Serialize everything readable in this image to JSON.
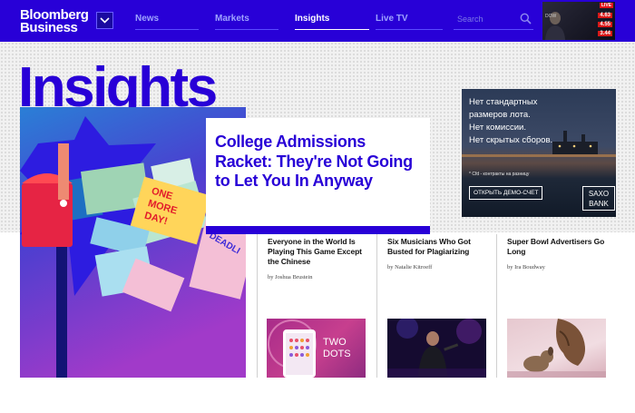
{
  "header": {
    "logo_line1": "Bloomberg",
    "logo_line2": "Business",
    "nav": [
      {
        "label": "News"
      },
      {
        "label": "Markets"
      },
      {
        "label": "Insights"
      },
      {
        "label": "Live TV"
      }
    ],
    "search_placeholder": "Search",
    "live_tv": {
      "badge": "LIVE",
      "tickers": [
        {
          "label": "DOW",
          "value": "4.63"
        },
        {
          "label": "",
          "value": "4.55"
        },
        {
          "label": "",
          "value": "3.44"
        }
      ]
    }
  },
  "page": {
    "heading": "Insights"
  },
  "hero": {
    "art_sign": [
      "ONE",
      "MORE",
      "DAY!"
    ],
    "art_deadline": "DEADLI",
    "title": "College Admissions Racket: They're Not Going to Let You In Anyway"
  },
  "ad": {
    "lines": [
      "Нет стандартных",
      "размеров лота.",
      "Нет комиссии.",
      "Нет скрытых сборов."
    ],
    "disclaimer": "* Cfd - контракты на разницу",
    "cta": "ОТКРЫТЬ ДЕМО-СЧЕТ",
    "brand_line1": "SAXO",
    "brand_line2": "BANK"
  },
  "stories": [
    {
      "title": "Everyone in the World Is Playing This Game Except the Chinese",
      "byline": "by Joshua Brustein",
      "thumb_text_line1": "TWO",
      "thumb_text_line2": "DOTS"
    },
    {
      "title": "Six Musicians Who Got Busted for Plagiarizing",
      "byline": "by Natalie Kitroeff"
    },
    {
      "title": "Super Bowl Advertisers Go Long",
      "byline": "by Ira Boudway"
    }
  ],
  "colors": {
    "brand_blue": "#2800d7",
    "live_red": "#e1131b"
  }
}
